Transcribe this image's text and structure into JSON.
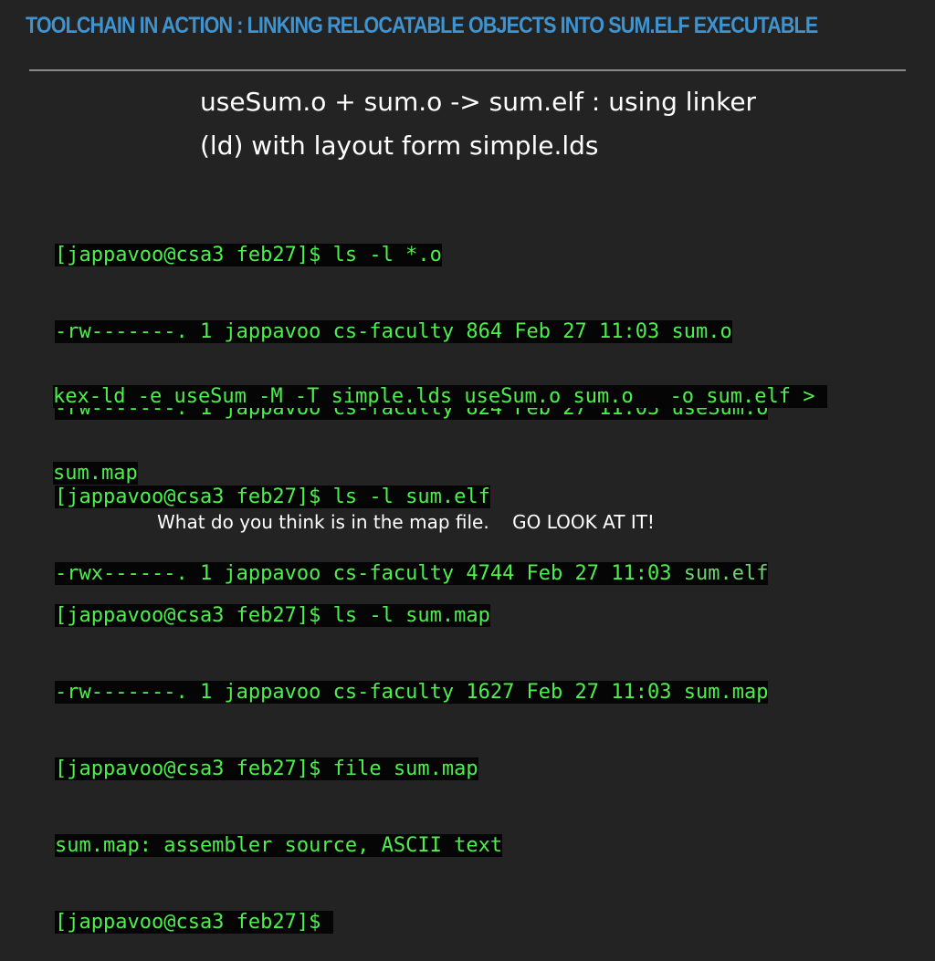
{
  "slide": {
    "title": "TOOLCHAIN IN ACTION :  LINKING RELOCATABLE OBJECTS INTO SUM.ELF EXECUTABLE",
    "subtitle_line1": "useSum.o + sum.o -> sum.elf : using linker",
    "subtitle_line2": "(ld) with layout form simple.lds",
    "question": "What do you think is in the map file.    GO LOOK AT IT!"
  },
  "terminal_block1": {
    "lines": [
      "[jappavoo@csa3 feb27]$ ls -l *.o",
      "-rw-------. 1 jappavoo cs-faculty 864 Feb 27 11:03 sum.o",
      "-rw-------. 1 jappavoo cs-faculty 824 Feb 27 11:03 useSum.o"
    ]
  },
  "terminal_block2": {
    "lines": [
      "kex-ld -e useSum -M -T simple.lds useSum.o sum.o   -o sum.elf > ",
      "sum.map"
    ]
  },
  "terminal_block3": {
    "line1": "[jappavoo@csa3 feb27]$ ls -l sum.elf",
    "line2_prefix": "-rwx------. 1 jappavoo cs-faculty 4744 Feb 27 11:03 ",
    "line2_file": "sum.elf"
  },
  "terminal_block4": {
    "lines": [
      "[jappavoo@csa3 feb27]$ ls -l sum.map",
      "-rw-------. 1 jappavoo cs-faculty 1627 Feb 27 11:03 sum.map",
      "[jappavoo@csa3 feb27]$ file sum.map",
      "sum.map: assembler source, ASCII text",
      "[jappavoo@csa3 feb27]$ "
    ]
  },
  "colors": {
    "background": "#232323",
    "title": "#3f93cf",
    "terminal_text": "#4cf04c",
    "terminal_bg": "#050505",
    "body_text": "#ffffff"
  }
}
